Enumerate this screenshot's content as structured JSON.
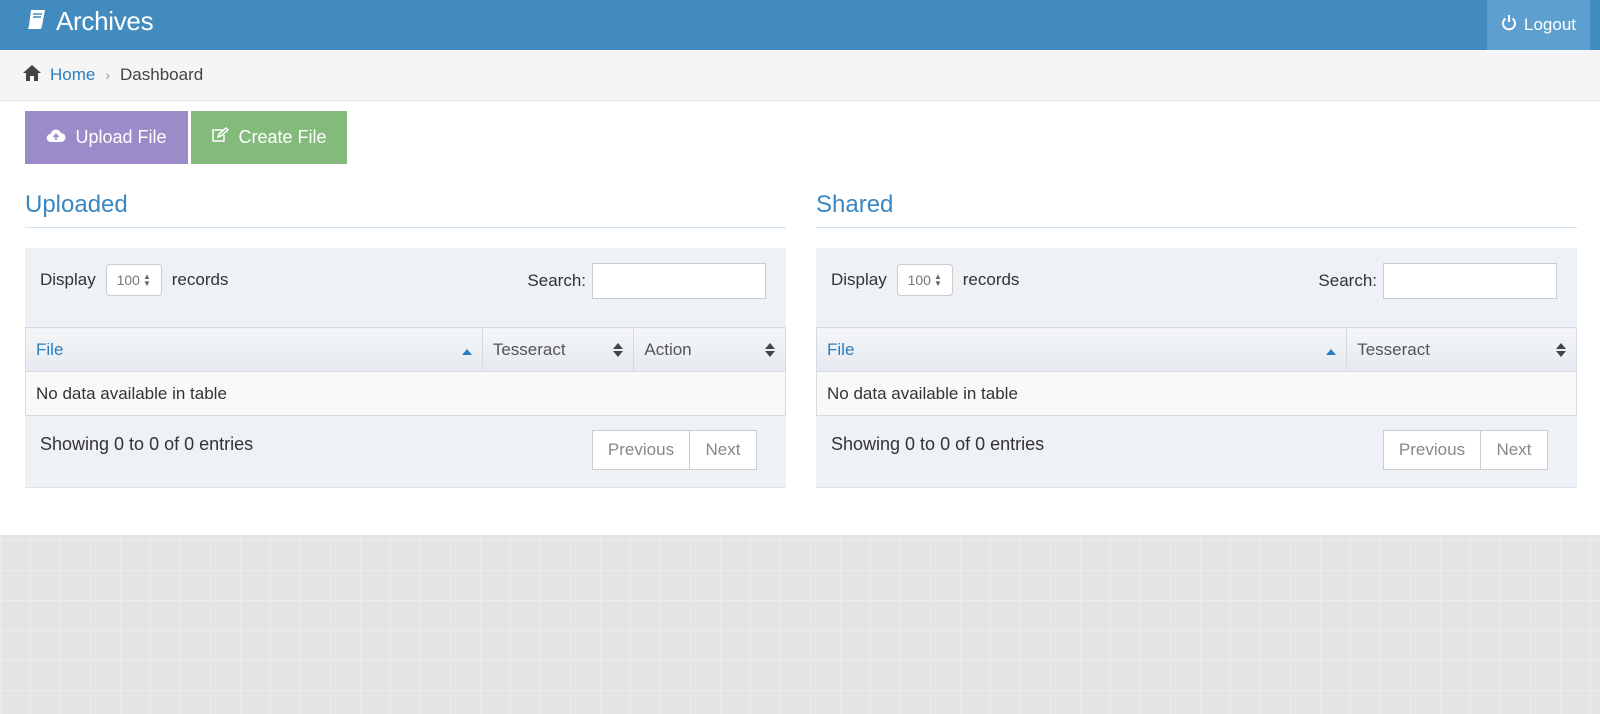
{
  "navbar": {
    "brand": "Archives",
    "logout_label": "Logout"
  },
  "breadcrumb": {
    "home": "Home",
    "current": "Dashboard"
  },
  "actions": {
    "upload_label": "Upload File",
    "create_label": "Create File"
  },
  "panels": [
    {
      "title": "Uploaded",
      "display_label": "Display",
      "records_value": "100",
      "records_label": "records",
      "search_label": "Search:",
      "search_value": "",
      "columns": [
        "File",
        "Tesseract",
        "Action"
      ],
      "empty_text": "No data available in table",
      "info": "Showing 0 to 0 of 0 entries",
      "prev_label": "Previous",
      "next_label": "Next"
    },
    {
      "title": "Shared",
      "display_label": "Display",
      "records_value": "100",
      "records_label": "records",
      "search_label": "Search:",
      "search_value": "",
      "columns": [
        "File",
        "Tesseract"
      ],
      "empty_text": "No data available in table",
      "info": "Showing 0 to 0 of 0 entries",
      "prev_label": "Previous",
      "next_label": "Next"
    }
  ],
  "colors": {
    "navbar": "#428bbf",
    "logout": "#5da0cf",
    "upload_button": "#9b8bc8",
    "create_button": "#84bb7c",
    "link": "#2c7ebf"
  },
  "icons": {
    "brand": "book-icon",
    "logout": "power-icon",
    "home": "home-icon",
    "upload": "cloud-upload-icon",
    "create": "edit-icon"
  }
}
